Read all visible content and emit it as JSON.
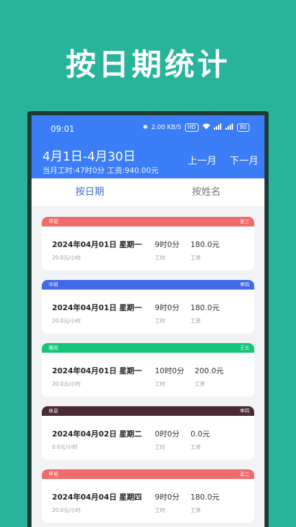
{
  "promo": {
    "title": "按日期统计"
  },
  "status_bar": {
    "time": "09:01",
    "speed": "2.00 KB/S",
    "hd": "HD",
    "battery": "80"
  },
  "header": {
    "range": "4月1日-4月30日",
    "summary": "当月工时:47时0分 工资:940.00元",
    "prev_label": "上一月",
    "next_label": "下一月",
    "color": "#3b7df7"
  },
  "tabs": [
    {
      "label": "按日期",
      "active": true
    },
    {
      "label": "按姓名",
      "active": false
    }
  ],
  "records": [
    {
      "shift": "早班",
      "name": "张三",
      "color": "#f26b6b",
      "date": "2024年04月01日 星期一",
      "rate": "20.0元/小时",
      "hours": "9时0分",
      "hours_label": "工时",
      "wage": "180.0元",
      "wage_label": "工资"
    },
    {
      "shift": "中班",
      "name": "李四",
      "color": "#3f6ae8",
      "date": "2024年04月01日 星期一",
      "rate": "20.0元/小时",
      "hours": "9时0分",
      "hours_label": "工时",
      "wage": "180.0元",
      "wage_label": "工资"
    },
    {
      "shift": "晚班",
      "name": "王五",
      "color": "#16c477",
      "date": "2024年04月01日 星期一",
      "rate": "20.0元/小时",
      "hours": "10时0分",
      "hours_label": "工时",
      "wage": "200.0元",
      "wage_label": "工资"
    },
    {
      "shift": "休息",
      "name": "李四",
      "color": "#4b2a34",
      "date": "2024年04月02日 星期二",
      "rate": "0.0元/小时",
      "hours": "0时0分",
      "hours_label": "工时",
      "wage": "0.0元",
      "wage_label": "工资"
    },
    {
      "shift": "早班",
      "name": "张三",
      "color": "#f26b6b",
      "date": "2024年04月04日 星期四",
      "rate": "20.0元/小时",
      "hours": "9时0分",
      "hours_label": "工时",
      "wage": "180.0元",
      "wage_label": "工资"
    }
  ]
}
